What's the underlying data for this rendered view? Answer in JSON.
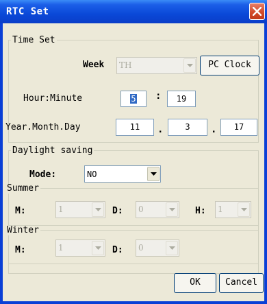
{
  "window": {
    "title": "RTC Set"
  },
  "time_set": {
    "group_label": "Time Set",
    "week_label": "Week",
    "week_value": "TH",
    "pc_clock_label": "PC Clock",
    "hour_minute_label": "Hour:Minute",
    "hour": "5",
    "minute_sep": ":",
    "minute": "19",
    "ymd_label": "Year.Month.Day",
    "year": "11",
    "month": "3",
    "day": "17",
    "date_sep": "."
  },
  "daylight": {
    "group_label": "Daylight saving",
    "mode_label": "Mode:",
    "mode_value": "NO",
    "summer": {
      "label": "Summer",
      "m_label": "M:",
      "m_value": "1",
      "d_label": "D:",
      "d_value": "0",
      "h_label": "H:",
      "h_value": "1"
    },
    "winter": {
      "label": "Winter",
      "m_label": "M:",
      "m_value": "1",
      "d_label": "D:",
      "d_value": "0"
    }
  },
  "buttons": {
    "ok": "OK",
    "cancel": "Cancel"
  }
}
